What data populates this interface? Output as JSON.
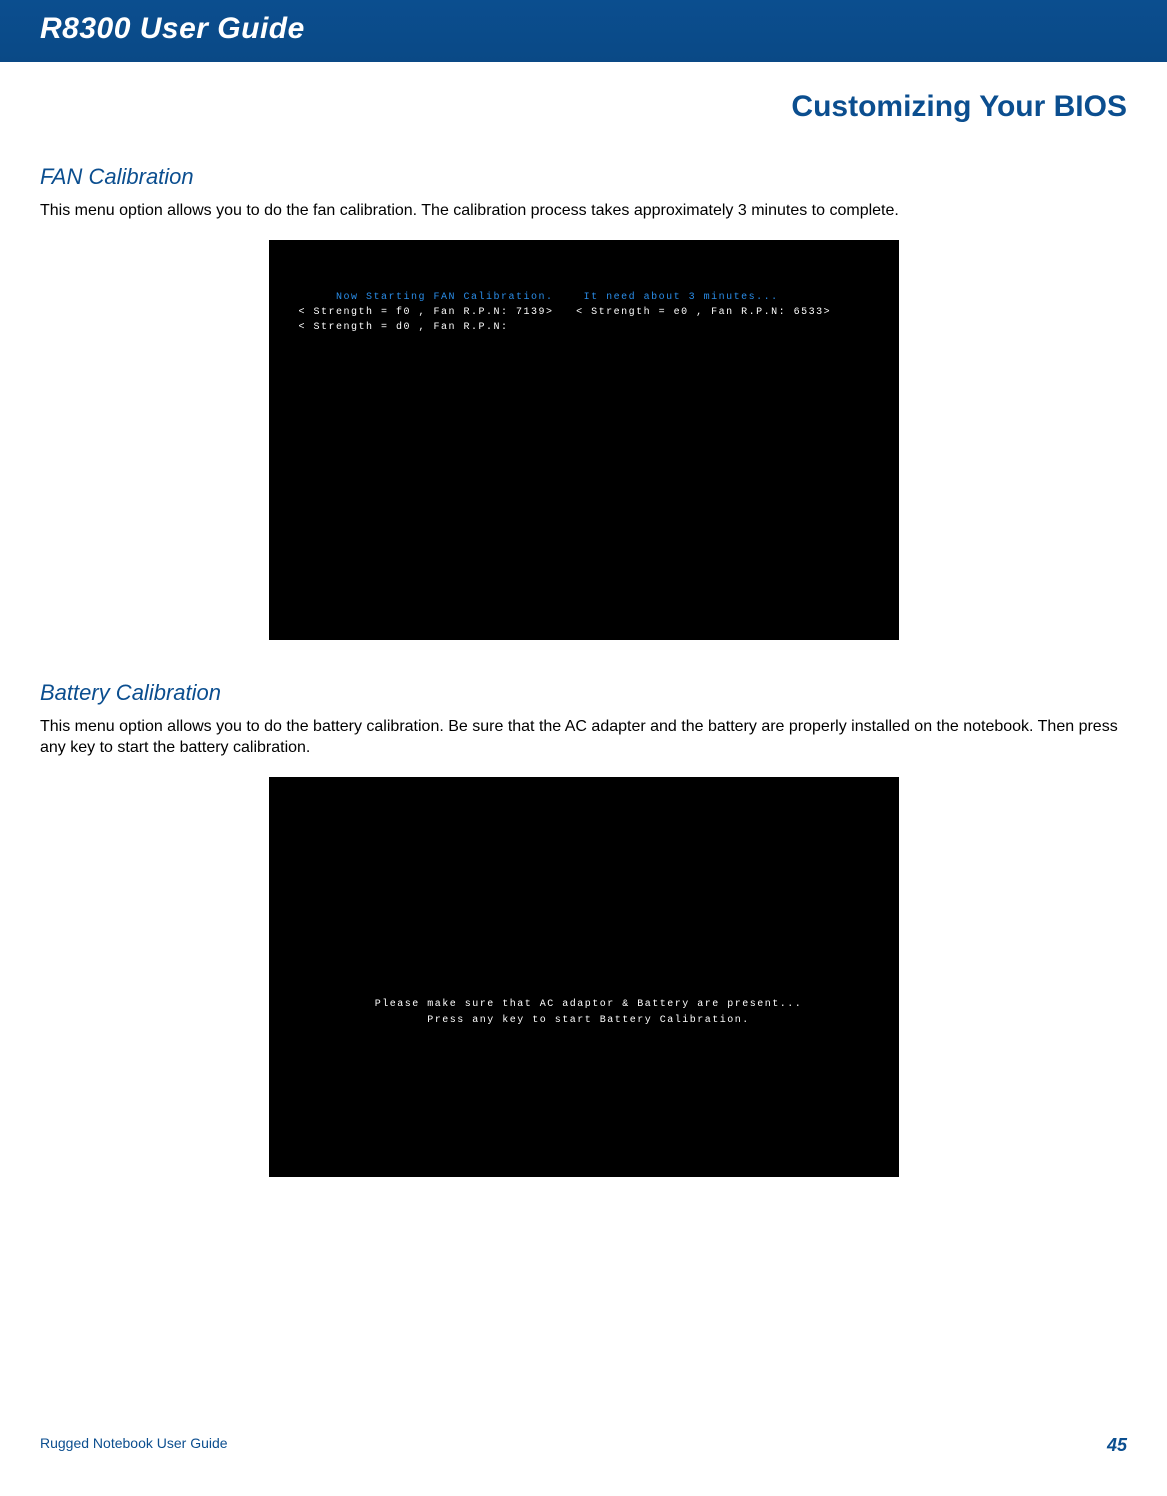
{
  "header": {
    "guide_title": "R8300 User Guide",
    "chapter_title": "Customizing Your BIOS"
  },
  "sections": {
    "fan": {
      "heading": "FAN Calibration",
      "body": "This menu option allows you to do the fan calibration. The calibration process takes approximately 3 minutes to complete.",
      "terminal": {
        "line1_blue_a": "Now Starting FAN Calibration.",
        "line1_blue_b": "It need about 3 minutes...",
        "line2_left": "< Strength = f0 , Fan R.P.N: 7139>",
        "line2_right": "< Strength = e0 , Fan R.P.N: 6533>",
        "line3": "< Strength = d0 , Fan R.P.N:"
      }
    },
    "battery": {
      "heading": "Battery Calibration",
      "body": "This menu option allows you to do the battery calibration. Be sure that the AC adapter and the battery are properly installed on the notebook. Then press any key to start the battery calibration.",
      "terminal": {
        "line1": "Please make  sure that AC adaptor & Battery are present...",
        "line2": "Press any key to start Battery Calibration."
      }
    }
  },
  "footer": {
    "left": "Rugged Notebook User Guide",
    "page": "45"
  }
}
